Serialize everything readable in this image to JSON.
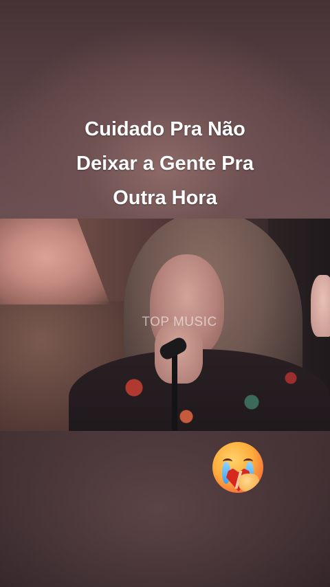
{
  "caption": {
    "lines": [
      "Cuidado Pra Não",
      "Deixar a Gente Pra",
      "Outra Hora"
    ]
  },
  "video": {
    "watermark": "TOP MUSIC"
  },
  "reaction": {
    "icon": "face-holding-back-tears-broken-heart-icon"
  },
  "colors": {
    "caption_text": "#ffffff",
    "background_top": "#463235",
    "background_mid": "#6a5052",
    "background_bottom": "#2f2225"
  }
}
